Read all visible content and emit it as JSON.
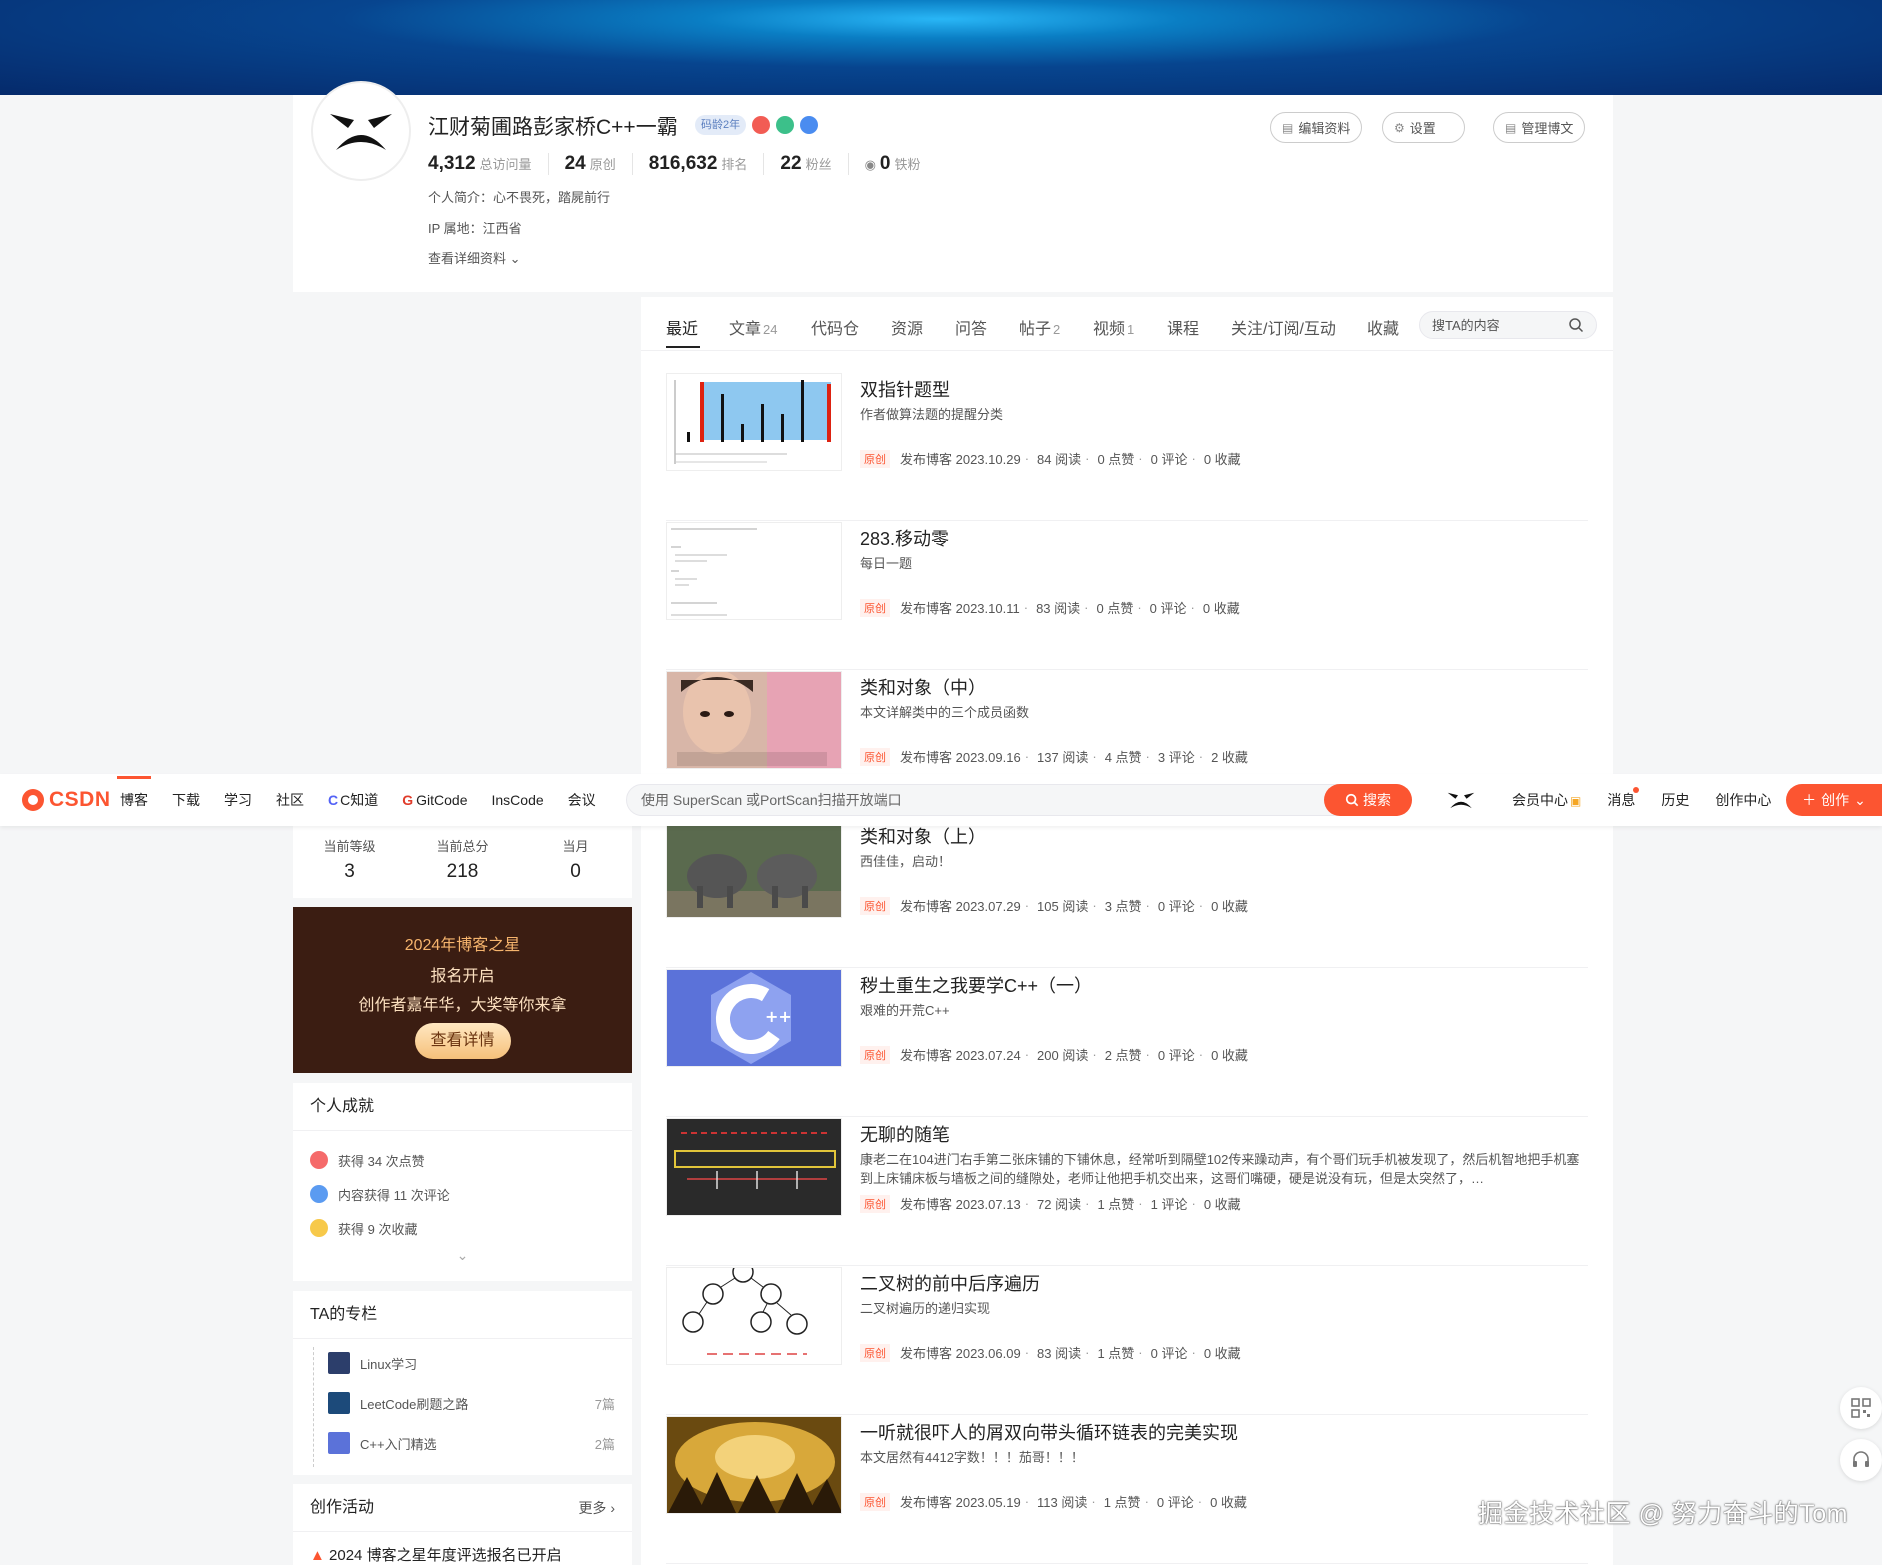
{
  "profile": {
    "name": "江财菊圃路彭家桥C++一霸",
    "code_age_badge": "码龄2年",
    "stats": [
      {
        "num": "4,312",
        "label": "总访问量"
      },
      {
        "num": "24",
        "label": "原创"
      },
      {
        "num": "816,632",
        "label": "排名"
      },
      {
        "num": "22",
        "label": "粉丝"
      },
      {
        "num": "0",
        "label": "铁粉"
      }
    ],
    "intro": "个人简介：心不畏死，踏屍前行",
    "ip": "IP 属地：江西省",
    "detail_link": "查看详细资料",
    "buttons": {
      "edit": "编辑资料",
      "settings": "设置",
      "manage": "管理博文"
    }
  },
  "topnav": {
    "logo": "CSDN",
    "links": [
      "博客",
      "下载",
      "学习",
      "社区",
      "C知道",
      "GitCode",
      "InsCode",
      "会议"
    ],
    "search_placeholder": "使用 SuperScan 或PortScan扫描开放端口",
    "search_button": "搜索",
    "right_links": [
      "会员中心",
      "消息",
      "历史",
      "创作中心"
    ],
    "create_button": "创作"
  },
  "sidebar": {
    "levels": [
      {
        "label": "当前等级",
        "value": "3"
      },
      {
        "label": "当前总分",
        "value": "218"
      },
      {
        "label": "当月",
        "value": "0"
      }
    ],
    "promo": {
      "line1": "2024年博客之星",
      "line2": "报名开启",
      "line3": "创作者嘉年华，大奖等你来拿",
      "button": "查看详情"
    },
    "achievements": {
      "title": "个人成就",
      "items": [
        "获得 34 次点赞",
        "内容获得 11 次评论",
        "获得 9 次收藏"
      ]
    },
    "columns": {
      "title": "TA的专栏",
      "items": [
        {
          "name": "Linux学习",
          "count": ""
        },
        {
          "name": "LeetCode刷题之路",
          "count": "7篇"
        },
        {
          "name": "C++入门精选",
          "count": "2篇"
        }
      ]
    },
    "activities": {
      "title": "创作活动",
      "more": "更多",
      "first_item": "2024 博客之星年度评选报名已开启"
    }
  },
  "tabs": [
    {
      "label": "最近",
      "count": ""
    },
    {
      "label": "文章",
      "count": "24"
    },
    {
      "label": "代码仓",
      "count": ""
    },
    {
      "label": "资源",
      "count": ""
    },
    {
      "label": "问答",
      "count": ""
    },
    {
      "label": "帖子",
      "count": "2"
    },
    {
      "label": "视频",
      "count": "1"
    },
    {
      "label": "课程",
      "count": ""
    },
    {
      "label": "关注/订阅/互动",
      "count": ""
    },
    {
      "label": "收藏",
      "count": ""
    }
  ],
  "tab_search_placeholder": "搜TA的内容",
  "articles": [
    {
      "title": "双指针题型",
      "desc": "作者做算法题的提醒分类",
      "tag": "原创",
      "pub": "发布博客 2023.10.29",
      "read": "84 阅读",
      "like": "0 点赞",
      "comment": "0 评论",
      "fav": "0 收藏"
    },
    {
      "title": "283.移动零",
      "desc": "每日一题",
      "tag": "原创",
      "pub": "发布博客 2023.10.11",
      "read": "83 阅读",
      "like": "0 点赞",
      "comment": "0 评论",
      "fav": "0 收藏"
    },
    {
      "title": "类和对象（中）",
      "desc": "本文详解类中的三个成员函数",
      "tag": "原创",
      "pub": "发布博客 2023.09.16",
      "read": "137 阅读",
      "like": "4 点赞",
      "comment": "3 评论",
      "fav": "2 收藏"
    },
    {
      "title": "类和对象（上）",
      "desc": "西佳佳，启动！",
      "tag": "原创",
      "pub": "发布博客 2023.07.29",
      "read": "105 阅读",
      "like": "3 点赞",
      "comment": "0 评论",
      "fav": "0 收藏"
    },
    {
      "title": "秽土重生之我要学C++（一）",
      "desc": "艰难的开荒C++",
      "tag": "原创",
      "pub": "发布博客 2023.07.24",
      "read": "200 阅读",
      "like": "2 点赞",
      "comment": "0 评论",
      "fav": "0 收藏"
    },
    {
      "title": "无聊的随笔",
      "desc": "康老二在104进门右手第二张床铺的下铺休息，经常听到隔壁102传来躁动声，有个哥们玩手机被发现了，然后机智地把手机塞到上床铺床板与墙板之间的缝隙处，老师让他把手机交出来，这哥们嘴硬，硬是说没有玩，但是太突然了，…",
      "tag": "原创",
      "pub": "发布博客 2023.07.13",
      "read": "72 阅读",
      "like": "1 点赞",
      "comment": "1 评论",
      "fav": "0 收藏"
    },
    {
      "title": "二叉树的前中后序遍历",
      "desc": "二叉树遍历的递归实现",
      "tag": "原创",
      "pub": "发布博客 2023.06.09",
      "read": "83 阅读",
      "like": "1 点赞",
      "comment": "0 评论",
      "fav": "0 收藏"
    },
    {
      "title": "一听就很吓人的屑双向带头循环链表的完美实现",
      "desc": "本文居然有4412字数！！！茄哥！！！",
      "tag": "原创",
      "pub": "发布博客 2023.05.19",
      "read": "113 阅读",
      "like": "1 点赞",
      "comment": "0 评论",
      "fav": "0 收藏"
    }
  ],
  "watermark": "掘金技术社区 @ 努力奋斗的Tom"
}
